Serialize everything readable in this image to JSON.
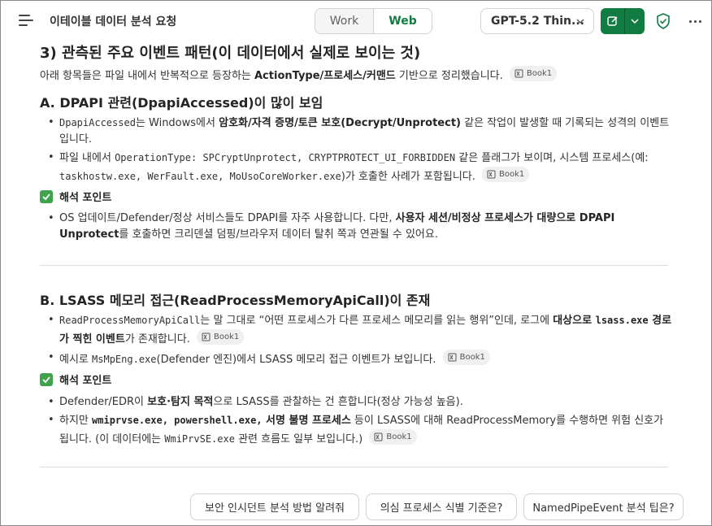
{
  "header": {
    "title": "이테이블 데이터 분석 요청",
    "tabs": [
      {
        "label": "Work",
        "active": false
      },
      {
        "label": "Web",
        "active": true
      }
    ],
    "model_label": "GPT-5.2 Thin...",
    "brand_color": "#107c41"
  },
  "main": {
    "heading": "3) 관측된 주요 이벤트 패턴(이 데이터에서 실제로 보이는 것)",
    "intro": {
      "prefix": "아래 항목들은 파일 내에서 반복적으로 등장하는 ",
      "bold": "ActionType/프로세스/커맨드",
      "suffix": " 기반으로 정리했습니다."
    },
    "citation_label": "Book1",
    "section_a": {
      "heading_prefix": "A. DPAPI 관련(",
      "heading_code": "DpapiAccessed",
      "heading_suffix": ")이 많이 보임",
      "bullet1": {
        "code": "DpapiAccessed",
        "text1": "는 Windows에서 ",
        "bold": "암호화/자격 증명/토큰 보호(Decrypt/Unprotect)",
        "text2": " 같은 작업이 발생할 때 기록되는 성격의 이벤트입니다."
      },
      "bullet2": {
        "text1": "파일 내에서 ",
        "code1": "OperationType: SPCryptUnprotect, CRYPTPROTECT_UI_FORBIDDEN",
        "text2": " 같은 플래그가 보이며, 시스템 프로세스(예: ",
        "code2": "taskhostw.exe, WerFault.exe, MoUsoCoreWorker.exe",
        "text3": ")가 호출한 사례가 포함됩니다."
      },
      "point_title": "해석 포인트",
      "point_bullet": {
        "text1": "OS 업데이트/Defender/정상 서비스들도 DPAPI를 자주 사용합니다. 다만, ",
        "bold": "사용자 세션/비정상 프로세스가 대량으로 DPAPI Unprotect",
        "text2": "를 호출하면 크리덴셜 덤핑/브라우저 데이터 탈취 쪽과 연관될 수 있어요."
      }
    },
    "section_b": {
      "heading_prefix": "B. LSASS 메모리 접근(",
      "heading_code": "ReadProcessMemoryApiCall",
      "heading_suffix": ")이 존재",
      "bullet1": {
        "code": "ReadProcessMemoryApiCall",
        "text1": "는 말 그대로 “어떤 프로세스가 다른 프로세스 메모리를 읽는 행위”인데, 로그에 ",
        "bold1": "대상으로 ",
        "bold_code": "lsass.exe",
        "bold2": " 경로가 찍힌 이벤트",
        "text2": "가 존재합니다."
      },
      "bullet2": {
        "text1": "예시로 ",
        "code": "MsMpEng.exe",
        "text2": "(Defender 엔진)에서 LSASS 메모리 접근 이벤트가 보입니다."
      },
      "point_title": "해석 포인트",
      "point_bullet1": {
        "text1": "Defender/EDR이 ",
        "bold": "보호·탐지 목적",
        "text2": "으로 LSASS를 관찰하는 건 흔합니다(정상 가능성 높음)."
      },
      "point_bullet2": {
        "text1": "하지만 ",
        "bold_code": "wmiprvse.exe, powershell.exe,",
        "bold": " 서명 불명 프로세스",
        "text2": " 등이 LSASS에 대해 ReadProcessMemory를 수행하면 위험 신호가 됩니다. (이 데이터에는 ",
        "code": "WmiPrvSE.exe",
        "text3": " 관련 흐름도 일부 보입니다.)"
      }
    }
  },
  "suggestions": [
    "보안 인시던트 분석 방법 알려줘",
    "의심 프로세스 식별 기준은?",
    "NamedPipeEvent 분석 팁은?"
  ]
}
